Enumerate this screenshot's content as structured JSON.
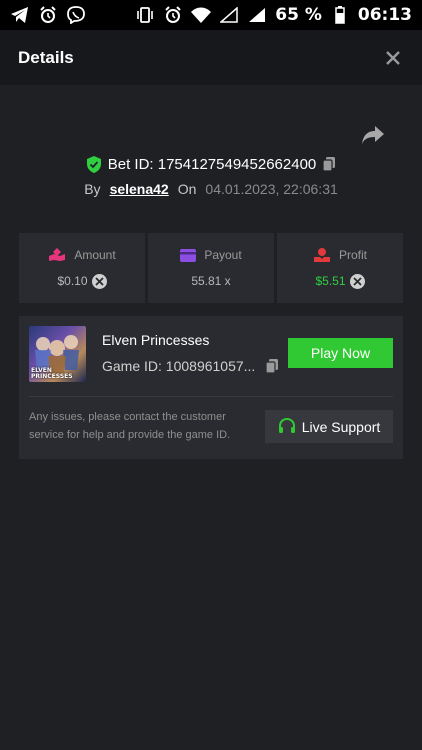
{
  "status_bar": {
    "left_icons": [
      "telegram-icon",
      "alarm-icon",
      "viber-icon"
    ],
    "right_icons": [
      "vibrate-icon",
      "alarm-icon",
      "wifi-icon",
      "signal-icon",
      "signal-icon"
    ],
    "battery": "65 %",
    "time": "06:13"
  },
  "header": {
    "title": "Details"
  },
  "bet": {
    "id_text": "Bet ID: 1754127549452662400",
    "by_label": "By",
    "username": "selena42",
    "on_label": "On",
    "date": "04.01.2023, 22:06:31"
  },
  "stats": [
    {
      "label": "Amount",
      "value": "$0.10",
      "icon": "amount-icon",
      "color": "#e6357a"
    },
    {
      "label": "Payout",
      "value": "55.81 x",
      "icon": "wallet-icon",
      "color": "#8a4fe0"
    },
    {
      "label": "Profit",
      "value": "$5.51",
      "icon": "profit-icon",
      "color": "#e23a3a"
    }
  ],
  "game": {
    "name": "Elven Princesses",
    "game_id": "Game ID: 1008961057...",
    "thumb_title": "ELVEN PRINCESSES",
    "play_label": "Play Now"
  },
  "support": {
    "text": "Any issues, please contact the customer service for help and provide the game ID.",
    "button_label": "Live Support"
  },
  "colors": {
    "accent_green": "#31c933",
    "profit_green": "#2fcf41",
    "background": "#1f2024"
  }
}
